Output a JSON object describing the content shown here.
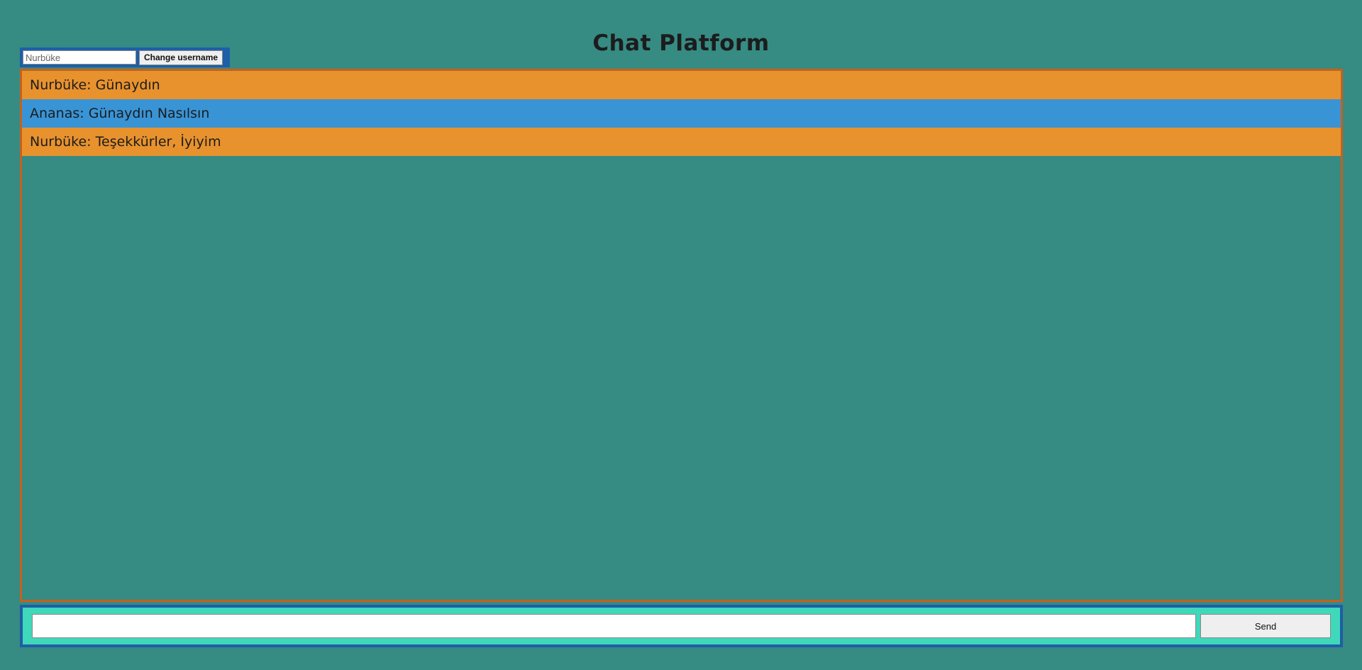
{
  "page": {
    "title": "Chat Platform"
  },
  "username": {
    "value": "Nurbüke",
    "button_label": "Change username"
  },
  "messages": [
    {
      "text": "Nurbüke: Günaydın",
      "color": "#e8922e"
    },
    {
      "text": "Ananas: Günaydın Nasılsın",
      "color": "#3994d6"
    },
    {
      "text": "Nurbüke: Teşekkürler, İyiyim",
      "color": "#e8922e"
    }
  ],
  "composer": {
    "value": "",
    "send_label": "Send"
  },
  "colors": {
    "messages_border": "#c5611c",
    "composer_background": "#3fd8bb",
    "composer_border": "#1f5ea6",
    "username_bar": "#1d5fa8"
  }
}
